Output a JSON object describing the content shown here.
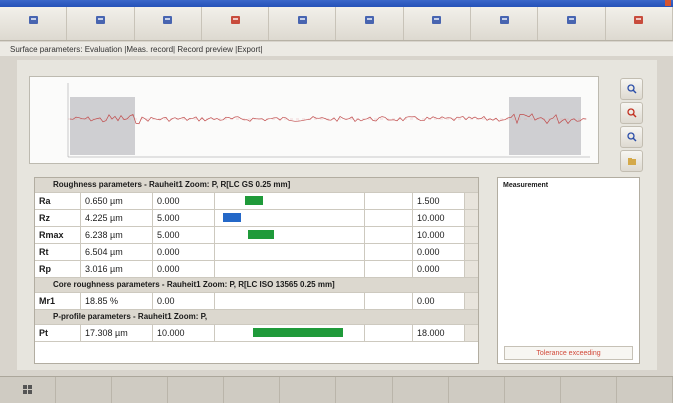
{
  "window": {
    "title": ""
  },
  "toolbar": {
    "buttons": [
      {
        "icon": "station-icon",
        "label": "",
        "color": "#2b4ea8"
      },
      {
        "icon": "printer-icon",
        "label": "",
        "color": "#2b4ea8"
      },
      {
        "icon": "measure-icon",
        "label": "",
        "color": "#2b4ea8"
      },
      {
        "icon": "evaluation-icon",
        "label": "",
        "color": "#c23020"
      },
      {
        "icon": "chart-icon",
        "label": "",
        "color": "#2b4ea8"
      },
      {
        "icon": "save-icon",
        "label": "",
        "color": "#2b4ea8"
      },
      {
        "icon": "pin-icon",
        "label": "",
        "color": "#2b4ea8"
      },
      {
        "icon": "settings-icon",
        "label": "",
        "color": "#2b4ea8"
      },
      {
        "icon": "help-icon",
        "label": "",
        "color": "#2b4ea8"
      },
      {
        "icon": "exit-icon",
        "label": "",
        "color": "#c23020"
      }
    ]
  },
  "menu": {
    "path": "Surface parameters: Evaluation |Meas. record| Record preview |Export|"
  },
  "profile_chart": {
    "y_ticks": [
      "",
      "",
      "",
      ""
    ],
    "tolerance_bands": 2
  },
  "side_tools": [
    {
      "icon": "zoom-icon"
    },
    {
      "icon": "edit-icon"
    },
    {
      "icon": "cursor-icon"
    },
    {
      "icon": "folder-icon"
    }
  ],
  "table": {
    "sections": [
      {
        "header": "Roughness parameters - Rauheit1  Zoom: P, R[LC GS 0.25 mm]",
        "rows": [
          {
            "name": "Ra",
            "value": "0.650 µm",
            "limit": "0.000",
            "max": "1.500",
            "bar_color": "#1f9a3a",
            "bar_start": 0.2,
            "bar_len": 0.12
          },
          {
            "name": "Rz",
            "value": "4.225 µm",
            "limit": "5.000",
            "max": "10.000",
            "bar_color": "#2468c8",
            "bar_start": 0.05,
            "bar_len": 0.12
          },
          {
            "name": "Rmax",
            "value": "6.238 µm",
            "limit": "5.000",
            "max": "10.000",
            "bar_color": "#1f9a3a",
            "bar_start": 0.22,
            "bar_len": 0.17
          },
          {
            "name": "Rt",
            "value": "6.504 µm",
            "limit": "0.000",
            "max": "0.000",
            "bar_color": "",
            "bar_start": 0,
            "bar_len": 0
          },
          {
            "name": "Rp",
            "value": "3.016 µm",
            "limit": "0.000",
            "max": "0.000",
            "bar_color": "",
            "bar_start": 0,
            "bar_len": 0
          }
        ]
      },
      {
        "header": "Core roughness parameters - Rauheit1  Zoom: P, R[LC ISO 13565 0.25 mm]",
        "rows": [
          {
            "name": "Mr1",
            "value": "18.85 %",
            "limit": "0.00",
            "max": "0.00",
            "bar_color": "",
            "bar_start": 0,
            "bar_len": 0
          }
        ]
      },
      {
        "header": "P-profile parameters - Rauheit1  Zoom: P,",
        "rows": [
          {
            "name": "Pt",
            "value": "17.308 µm",
            "limit": "10.000",
            "max": "18.000",
            "bar_color": "#1f9a3a",
            "bar_start": 0.25,
            "bar_len": 0.6
          }
        ]
      }
    ]
  },
  "measurement": {
    "title": "Measurement",
    "lines": [
      "",
      "",
      "",
      "",
      "",
      "",
      "",
      ""
    ],
    "tolerance_button": "Tolerance exceeding"
  },
  "footer": {
    "buttons": [
      {
        "icon": "grid-icon"
      },
      {
        "icon": ""
      },
      {
        "icon": ""
      },
      {
        "icon": ""
      },
      {
        "icon": ""
      },
      {
        "icon": ""
      },
      {
        "icon": ""
      },
      {
        "icon": ""
      },
      {
        "icon": ""
      },
      {
        "icon": ""
      },
      {
        "icon": ""
      },
      {
        "icon": ""
      }
    ],
    "status_left": "",
    "status_right": ""
  },
  "colors": {
    "accent": "#2451b8",
    "ok": "#1f9a3a",
    "warn": "#d24a3a",
    "info": "#2468c8"
  }
}
